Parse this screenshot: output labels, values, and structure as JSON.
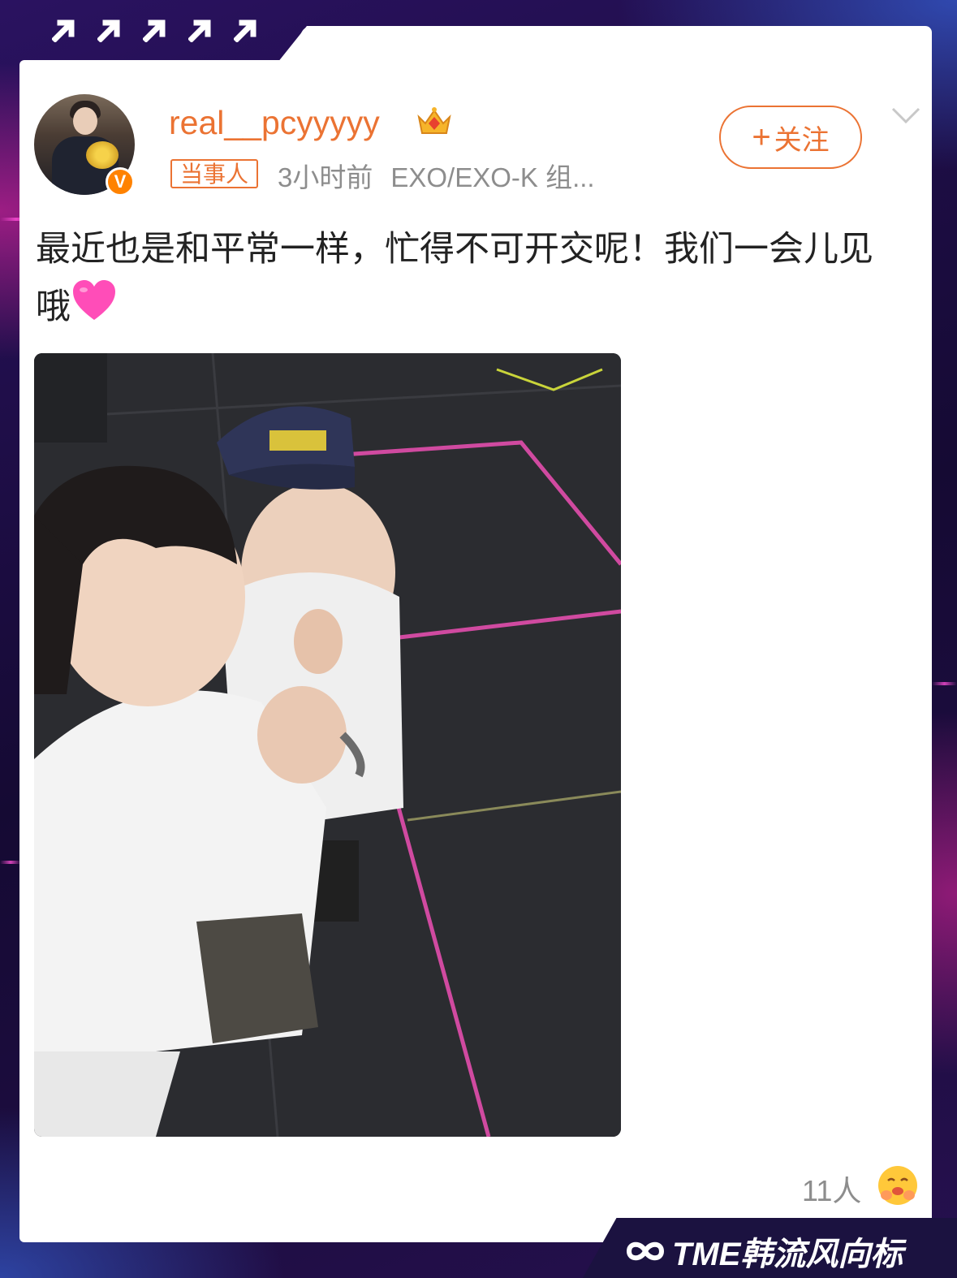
{
  "post": {
    "username": "real__pcyyyyy",
    "crown_icon": "crown-vip-icon",
    "verified_badge": "V",
    "role_tag": "当事人",
    "time": "3小时前",
    "source": "EXO/EXO-K 组...",
    "follow_label": "关注",
    "follow_plus": "+",
    "text": "最近也是和平常一样，忙得不可开交呢！我们一会儿见哦",
    "text_emoji": "pink-heart-icon",
    "reaction_count": "11人",
    "reaction_icon": "hug-emoji-icon"
  },
  "watermark": {
    "text": "TME韩流风向标",
    "logo_icon": "infinity-logo-icon"
  },
  "colors": {
    "accent": "#eb7333",
    "verified": "#ff8200",
    "text": "#222222",
    "meta": "#8d8d8d",
    "heart": "#ff4db8"
  }
}
